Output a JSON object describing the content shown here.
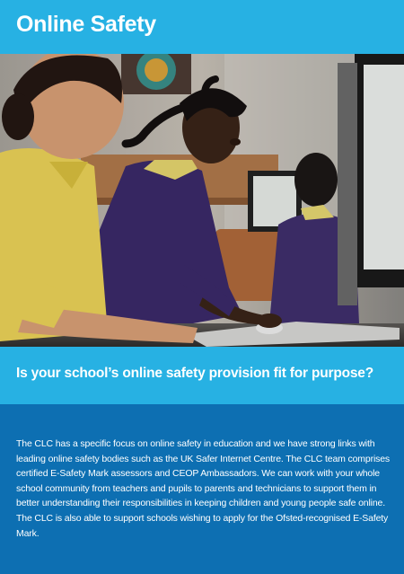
{
  "header": {
    "title": "Online Safety"
  },
  "photo": {
    "description_icon": "classroom-photo"
  },
  "question": {
    "text": "Is your school’s online safety provision fit for purpose?"
  },
  "body": {
    "paragraph": "The CLC has a specific focus on online safety in education and we have strong links with leading online safety bodies such as the UK Safer Internet Centre. The CLC team comprises certified E-Safety Mark assessors and CEOP Ambassadors. We can work with your whole school community from teachers and pupils to parents and technicians to support them in better understanding their responsibilities in keeping children and young people safe online. The CLC is also able to support schools wishing to apply for the Ofsted-recognised E-Safety Mark."
  },
  "colors": {
    "header_bg": "#27b1e3",
    "body_bg": "#0d6fb2",
    "text": "#ffffff"
  }
}
